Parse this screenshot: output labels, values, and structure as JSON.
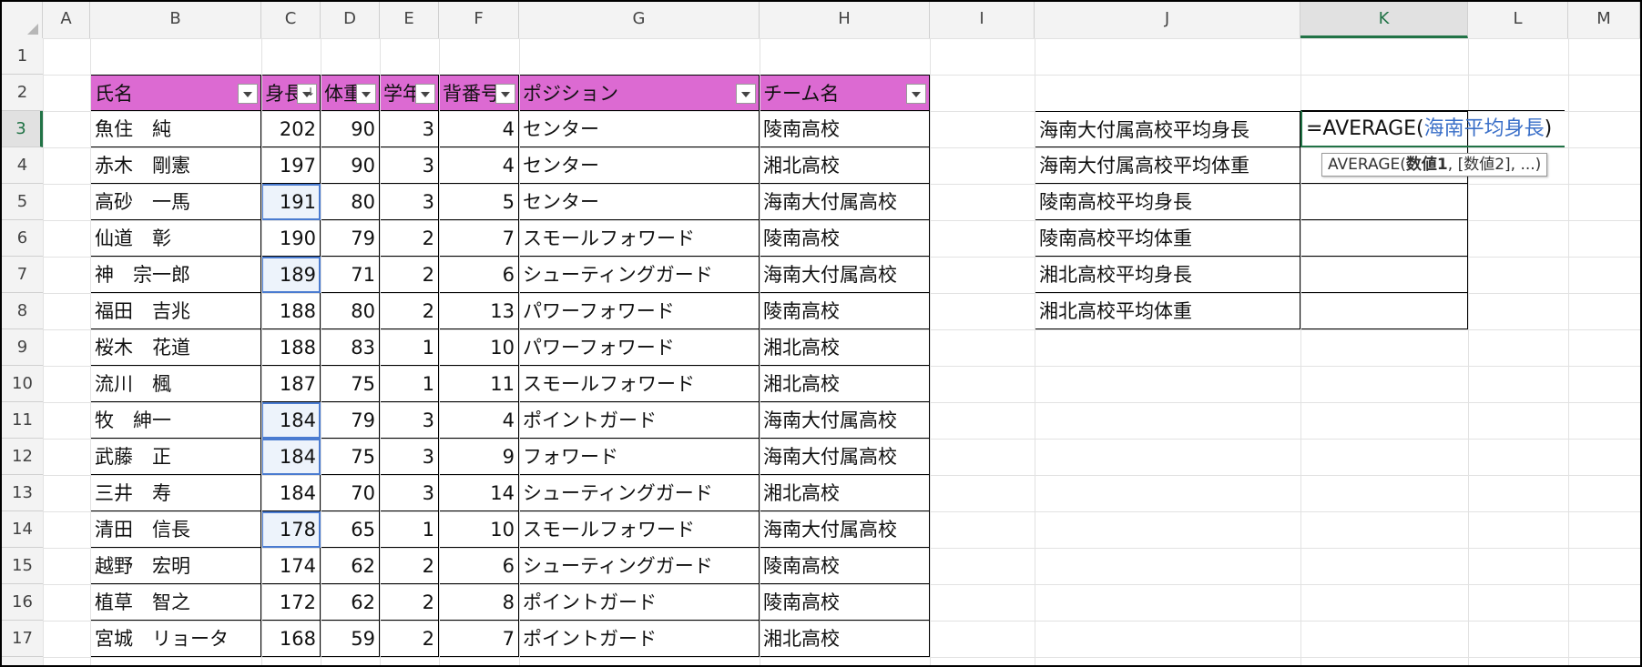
{
  "columns": [
    "A",
    "B",
    "C",
    "D",
    "E",
    "F",
    "G",
    "H",
    "I",
    "J",
    "K",
    "L",
    "M"
  ],
  "active_column": "K",
  "rows": [
    "1",
    "2",
    "3",
    "4",
    "5",
    "6",
    "7",
    "8",
    "9",
    "10",
    "11",
    "12",
    "13",
    "14",
    "15",
    "16",
    "17"
  ],
  "active_row": "3",
  "table": {
    "headers": [
      "氏名",
      "身長",
      "体重",
      "学年",
      "背番号",
      "ポジション",
      "チーム名"
    ],
    "rows": [
      [
        "魚住　純",
        "202",
        "90",
        "3",
        "4",
        "センター",
        "陵南高校"
      ],
      [
        "赤木　剛憲",
        "197",
        "90",
        "3",
        "4",
        "センター",
        "湘北高校"
      ],
      [
        "高砂　一馬",
        "191",
        "80",
        "3",
        "5",
        "センター",
        "海南大付属高校"
      ],
      [
        "仙道　彰",
        "190",
        "79",
        "2",
        "7",
        "スモールフォワード",
        "陵南高校"
      ],
      [
        "神　宗一郎",
        "189",
        "71",
        "2",
        "6",
        "シューティングガード",
        "海南大付属高校"
      ],
      [
        "福田　吉兆",
        "188",
        "80",
        "2",
        "13",
        "パワーフォワード",
        "陵南高校"
      ],
      [
        "桜木　花道",
        "188",
        "83",
        "1",
        "10",
        "パワーフォワード",
        "湘北高校"
      ],
      [
        "流川　楓",
        "187",
        "75",
        "1",
        "11",
        "スモールフォワード",
        "湘北高校"
      ],
      [
        "牧　紳一",
        "184",
        "79",
        "3",
        "4",
        "ポイントガード",
        "海南大付属高校"
      ],
      [
        "武藤　正",
        "184",
        "75",
        "3",
        "9",
        "フォワード",
        "海南大付属高校"
      ],
      [
        "三井　寿",
        "184",
        "70",
        "3",
        "14",
        "シューティングガード",
        "湘北高校"
      ],
      [
        "清田　信長",
        "178",
        "65",
        "1",
        "10",
        "スモールフォワード",
        "海南大付属高校"
      ],
      [
        "越野　宏明",
        "174",
        "62",
        "2",
        "6",
        "シューティングガード",
        "陵南高校"
      ],
      [
        "植草　智之",
        "172",
        "62",
        "2",
        "8",
        "ポイントガード",
        "陵南高校"
      ],
      [
        "宮城　リョータ",
        "168",
        "59",
        "2",
        "7",
        "ポイントガード",
        "湘北高校"
      ]
    ]
  },
  "summary": {
    "labels": [
      "海南大付属高校平均身長",
      "海南大付属高校平均体重",
      "陵南高校平均身長",
      "陵南高校平均体重",
      "湘北高校平均身長",
      "湘北高校平均体重"
    ]
  },
  "formula": {
    "prefix": "=AVERAGE(",
    "reference": "海南平均身長",
    "suffix": ")"
  },
  "tooltip": {
    "func": "AVERAGE(",
    "arg1": "数値1",
    "rest": ", [数値2], ...)"
  },
  "colors": {
    "header_fill": "#dc6ad2",
    "reference_text": "#3a6fc8",
    "active_cell": "#217346",
    "highlight_border": "#4a7bd0"
  }
}
